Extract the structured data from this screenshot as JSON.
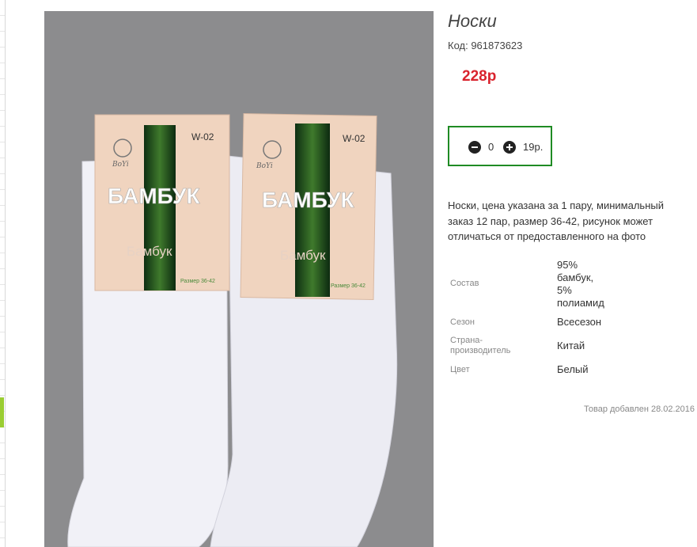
{
  "product": {
    "title": "Носки",
    "code": "Код: 961873623",
    "price": "228р"
  },
  "quantity": {
    "value": "0",
    "unit_price": "19р."
  },
  "description": {
    "line1": "Носки, цена указана за 1 пару, минимальный",
    "line2": "заказ 12 пар, размер 36-42, рисунок может",
    "line3": "отличаться от предоставленного на фото"
  },
  "specs": {
    "composition_label": "Состав",
    "composition_lines": [
      "95%",
      "бамбук,",
      "5%",
      "полиамид"
    ],
    "season_label": "Сезон",
    "season_value": "Всесезон",
    "country_label_lines": [
      "Страна-",
      "производитель"
    ],
    "country_value": "Китай",
    "color_label": "Цвет",
    "color_value": "Белый"
  },
  "added_text": "Товар добавлен 28.02.2016",
  "image_labels": {
    "model": "W-02",
    "brand_word": "БАМБУК",
    "sub_word": "Бамбук",
    "size": "Размер 36-42",
    "logo": "BoYi"
  },
  "colors": {
    "price": "#d9232d",
    "qty_border": "#1f8b24",
    "photo_bg": "#8c8c8e"
  }
}
